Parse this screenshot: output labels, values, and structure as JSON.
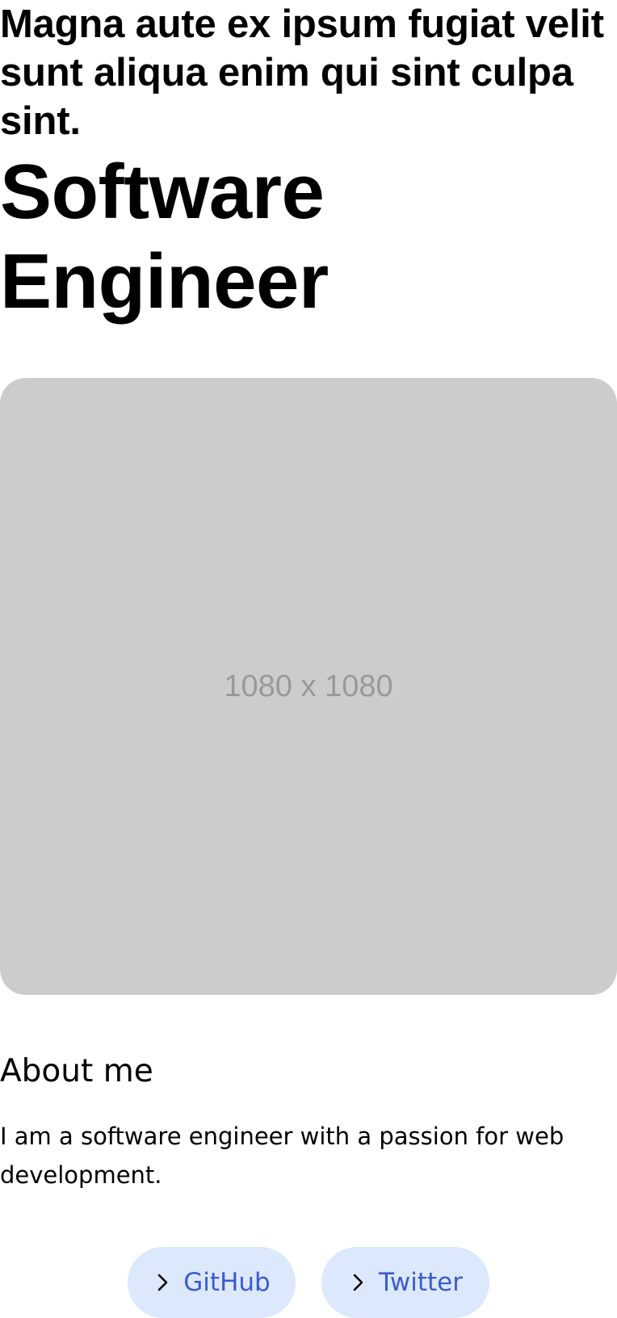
{
  "header": {
    "tagline": "Magna aute ex ipsum fugiat velit sunt aliqua enim qui sint culpa sint.",
    "title": "Software Engineer"
  },
  "hero": {
    "image_label": "1080 x 1080"
  },
  "about": {
    "heading": "About me",
    "text": "I am a software engineer with a passion for web development."
  },
  "links": [
    {
      "label": "GitHub",
      "icon": "chevron-right-icon"
    },
    {
      "label": "Twitter",
      "icon": "chevron-right-icon"
    }
  ],
  "colors": {
    "image_placeholder": "#cccccc",
    "button_background": "#dce8fb",
    "link_text": "#3b5ccf"
  }
}
